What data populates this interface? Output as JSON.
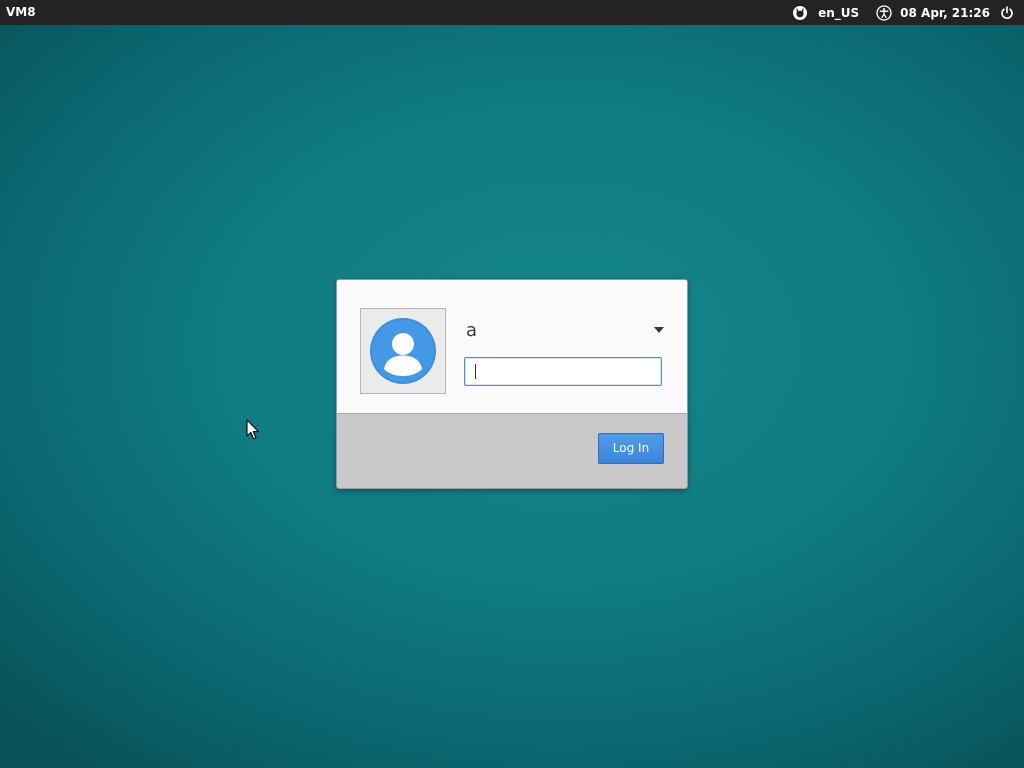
{
  "topbar": {
    "hostname": "VM8",
    "indicators": {
      "session_icon": "session-badge-icon",
      "language": "en_US",
      "accessibility_icon": "accessibility-icon",
      "clock": "08 Apr, 21:26",
      "power_icon": "power-icon"
    }
  },
  "login": {
    "avatar_icon": "user-avatar-icon",
    "username": "a",
    "user_menu_icon": "chevron-down-icon",
    "password_value": "",
    "login_button_label": "Log In"
  },
  "colors": {
    "background": "#0f7b82",
    "topbar": "#232323",
    "accent": "#3a86de",
    "avatar": "#3b8fe0"
  }
}
